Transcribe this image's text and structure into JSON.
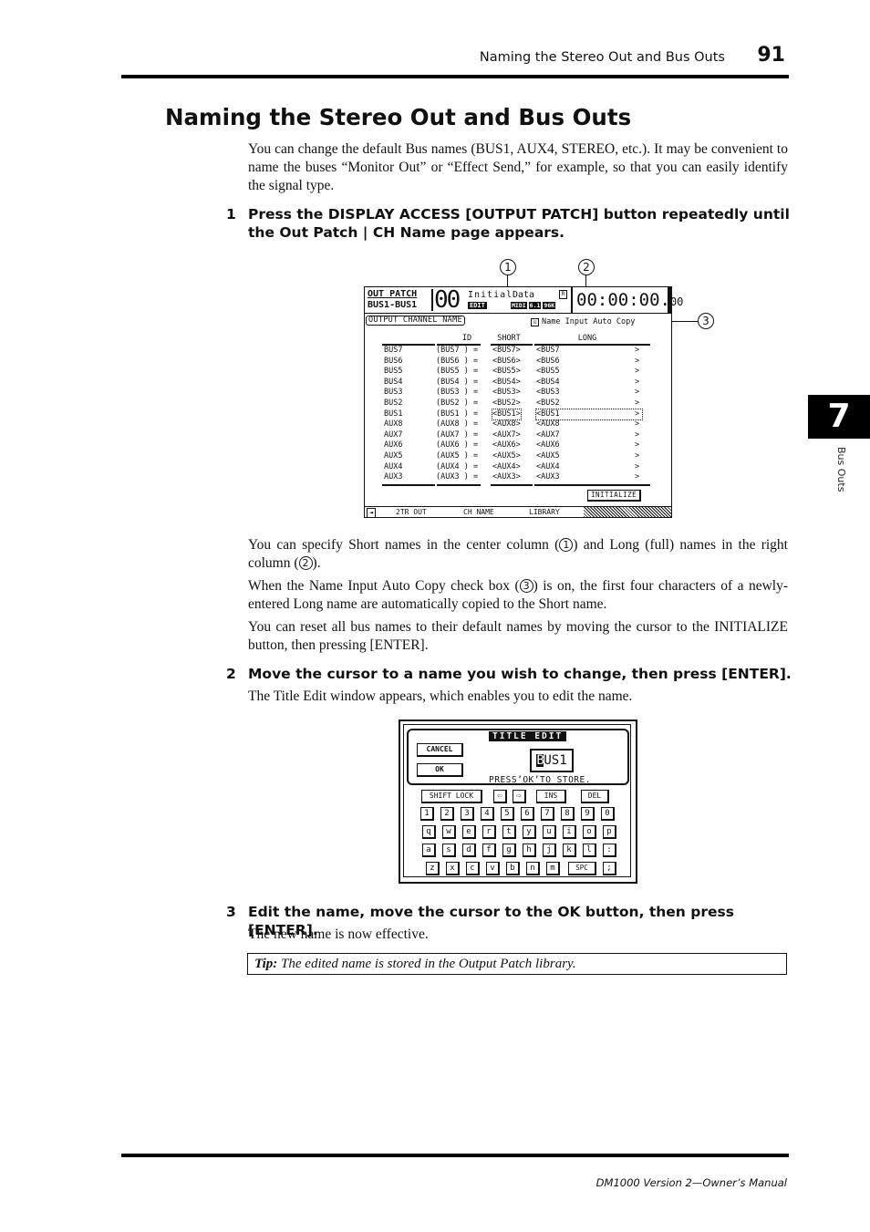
{
  "header": {
    "running_title": "Naming the Stereo Out and Bus Outs",
    "page_number": "91"
  },
  "chapter_tab": {
    "number": "7",
    "side_label": "Bus Outs"
  },
  "section_title": "Naming the Stereo Out and Bus Outs",
  "intro": "You can change the default Bus names (BUS1, AUX4, STEREO, etc.). It may be convenient to name the buses “Monitor Out” or “Effect Send,” for example, so that you can easily identify the signal type.",
  "steps": [
    {
      "num": "1",
      "text": "Press the DISPLAY ACCESS [OUTPUT PATCH] button repeatedly until the Out Patch | CH Name page appears."
    },
    {
      "num": "2",
      "text": "Move the cursor to a name you wish to change, then press [ENTER]."
    },
    {
      "num": "3",
      "text": "Edit the name, move the cursor to the OK button, then press [ENTER]."
    }
  ],
  "screen1": {
    "title": "OUT PATCH",
    "subtitle": "BUS1-BUS1",
    "scene_number": "00",
    "scene_name_1": "Initial",
    "scene_name_2": "Data",
    "edit_badge": "EDIT",
    "status_badges": [
      "MIDI",
      "6.1",
      "96K"
    ],
    "r_indicator": "R",
    "timecode_main": "00:00:00.",
    "timecode_frames": "00",
    "page_label": "OUTPUT CHANNEL NAME",
    "autocopy_checkbox": {
      "checked": true,
      "label": "Name Input Auto Copy",
      "mark": "☒"
    },
    "columns": {
      "id": "ID",
      "short": "SHORT",
      "long": "LONG"
    },
    "rows": [
      {
        "id": "BUS7",
        "id_paren": "(BUS7 ) =",
        "short": "<BUS7>",
        "long": "<BUS7",
        "end": ">"
      },
      {
        "id": "BUS6",
        "id_paren": "(BUS6 ) =",
        "short": "<BUS6>",
        "long": "<BUS6",
        "end": ">"
      },
      {
        "id": "BUS5",
        "id_paren": "(BUS5 ) =",
        "short": "<BUS5>",
        "long": "<BUS5",
        "end": ">"
      },
      {
        "id": "BUS4",
        "id_paren": "(BUS4 ) =",
        "short": "<BUS4>",
        "long": "<BUS4",
        "end": ">"
      },
      {
        "id": "BUS3",
        "id_paren": "(BUS3 ) =",
        "short": "<BUS3>",
        "long": "<BUS3",
        "end": ">"
      },
      {
        "id": "BUS2",
        "id_paren": "(BUS2 ) =",
        "short": "<BUS2>",
        "long": "<BUS2",
        "end": ">"
      },
      {
        "id": "BUS1",
        "id_paren": "(BUS1 ) =",
        "short": "<BUS1>",
        "long": "<BUS1",
        "end": ">",
        "selected": true
      },
      {
        "id": "AUX8",
        "id_paren": "(AUX8 ) =",
        "short": "<AUX8>",
        "long": "<AUX8",
        "end": ">"
      },
      {
        "id": "AUX7",
        "id_paren": "(AUX7 ) =",
        "short": "<AUX7>",
        "long": "<AUX7",
        "end": ">"
      },
      {
        "id": "AUX6",
        "id_paren": "(AUX6 ) =",
        "short": "<AUX6>",
        "long": "<AUX6",
        "end": ">"
      },
      {
        "id": "AUX5",
        "id_paren": "(AUX5 ) =",
        "short": "<AUX5>",
        "long": "<AUX5",
        "end": ">"
      },
      {
        "id": "AUX4",
        "id_paren": "(AUX4 ) =",
        "short": "<AUX4>",
        "long": "<AUX4",
        "end": ">"
      },
      {
        "id": "AUX3",
        "id_paren": "(AUX3 ) =",
        "short": "<AUX3>",
        "long": "<AUX3",
        "end": ">"
      }
    ],
    "initialize_button": "INITIALIZE",
    "tabs": {
      "back": "◄",
      "items": [
        "2TR OUT",
        "CH NAME",
        "LIBRARY"
      ],
      "active": "CH NAME"
    },
    "callouts": [
      "1",
      "2",
      "3"
    ]
  },
  "para_after_screen1": [
    {
      "before": "You can specify Short names in the center column (",
      "c1": "1",
      "middle": ") and Long (full) names in the right column (",
      "c2": "2",
      "after": ")."
    },
    {
      "before": "When the Name Input Auto Copy check box (",
      "c1": "3",
      "after": ") is on, the first four characters of a newly-entered Long name are automatically copied to the Short name."
    },
    {
      "text": "You can reset all bus names to their default names by moving the cursor to the INITIALIZE button, then pressing [ENTER]."
    }
  ],
  "step2_desc": "The Title Edit window appears, which enables you to edit the name.",
  "screen2": {
    "title": "TITLE EDIT",
    "cancel": "CANCEL",
    "ok": "OK",
    "name_cursor_char": "B",
    "name_rest": "US1",
    "message": "PRESS’OK’TO STORE.",
    "controls": {
      "shift_lock": "SHIFT LOCK",
      "left": "⇦",
      "right": "⇨",
      "ins": "INS",
      "del": "DEL"
    },
    "keyboard": [
      [
        "1",
        "2",
        "3",
        "4",
        "5",
        "6",
        "7",
        "8",
        "9",
        "0"
      ],
      [
        "q",
        "w",
        "e",
        "r",
        "t",
        "y",
        "u",
        "i",
        "o",
        "p"
      ],
      [
        "a",
        "s",
        "d",
        "f",
        "g",
        "h",
        "j",
        "k",
        "l",
        ":"
      ],
      [
        "z",
        "x",
        "c",
        "v",
        "b",
        "n",
        "m",
        "SPC",
        ";"
      ]
    ]
  },
  "step3_desc": "The new name is now effective.",
  "tip": {
    "label": "Tip:",
    "text": "The edited name is stored in the Output Patch library."
  },
  "footer": "DM1000 Version 2—Owner’s Manual"
}
